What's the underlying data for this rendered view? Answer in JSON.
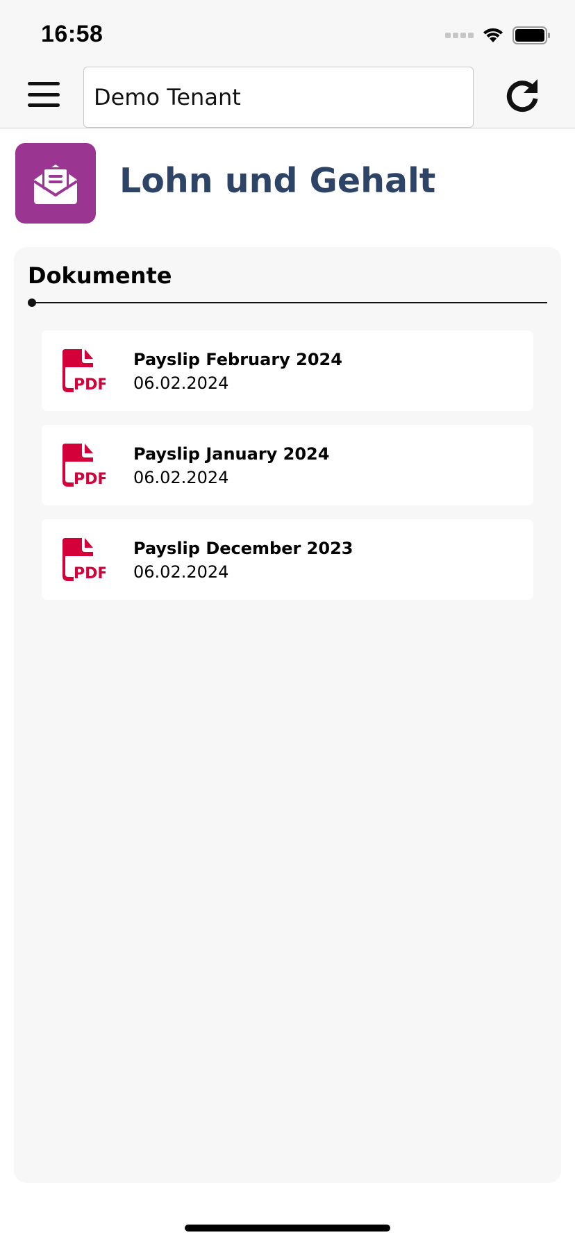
{
  "status_bar": {
    "time": "16:58"
  },
  "header": {
    "menu_icon": "hamburger-menu-icon",
    "tenant_value": "Demo Tenant",
    "refresh_icon": "refresh-icon"
  },
  "page": {
    "tile_icon": "open-envelope-icon",
    "tile_color": "#9a3592",
    "title": "Lohn und Gehalt",
    "title_color": "#2d4466"
  },
  "documents": {
    "heading": "Dokumente",
    "icon": "pdf-file-icon",
    "icon_color": "#d4003a",
    "items": [
      {
        "title": "Payslip February 2024",
        "date": "06.02.2024"
      },
      {
        "title": "Payslip January 2024",
        "date": "06.02.2024"
      },
      {
        "title": "Payslip December 2023",
        "date": "06.02.2024"
      }
    ]
  }
}
